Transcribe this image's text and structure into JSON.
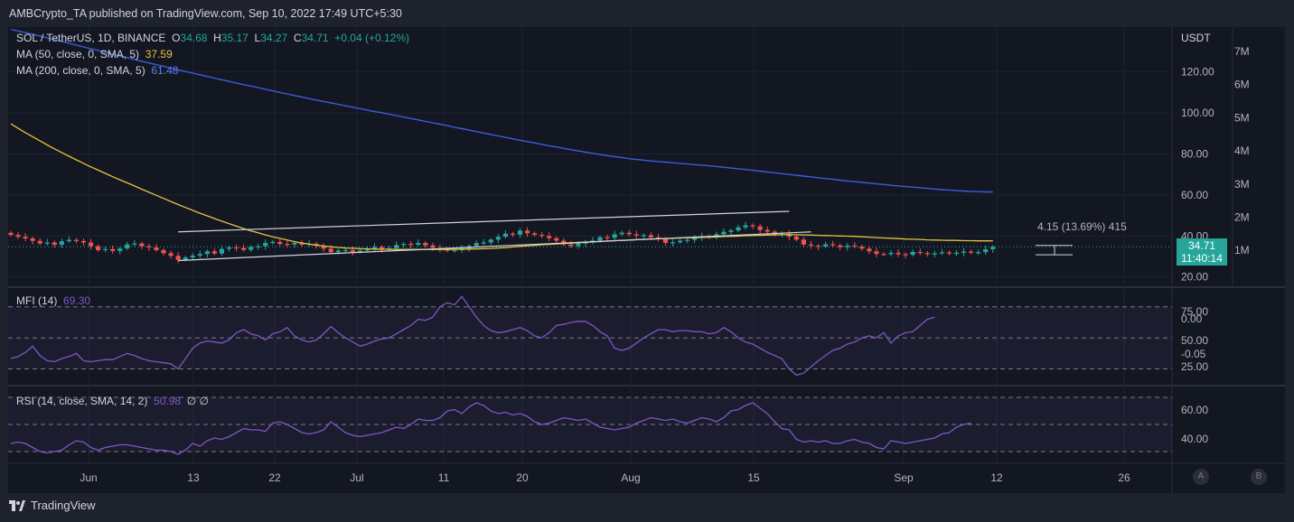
{
  "header": {
    "published": "AMBCrypto_TA published on TradingView.com, Sep 10, 2022 17:49 UTC+5:30"
  },
  "legend": {
    "symbol": "SOL / TetherUS, 1D, BINANCE",
    "o_label": "O",
    "o_value": "34.68",
    "h_label": "H",
    "h_value": "35.17",
    "l_label": "L",
    "l_value": "34.27",
    "c_label": "C",
    "c_value": "34.71",
    "change": "+0.04 (+0.12%)",
    "ma50_label": "MA (50, close, 0, SMA, 5)",
    "ma50_value": "37.59",
    "ma200_label": "MA (200, close, 0, SMA, 5)",
    "ma200_value": "61.48",
    "mfi_label": "MFI (14)",
    "mfi_value": "69.30",
    "rsi_label": "RSI (14, close, SMA, 14, 2)",
    "rsi_value": "50.98",
    "rsi_extra": "∅ ∅"
  },
  "currency": "USDT",
  "price_label": {
    "value": "34.71",
    "countdown": "11:40:14"
  },
  "measure_label": "4.15 (13.69%) 415",
  "buttons": {
    "a": "A",
    "b": "B"
  },
  "footer": {
    "brand": "TradingView"
  },
  "colors": {
    "up": "#26a69a",
    "down": "#ef5350",
    "ma50": "#e5c33e",
    "ma200": "#3c5ddb",
    "osc": "#7e57c2"
  },
  "chart_data": [
    {
      "type": "candlestick",
      "title": "SOL / TetherUS, 1D, BINANCE",
      "x_ticks": [
        "Jun",
        "13",
        "22",
        "Jul",
        "11",
        "20",
        "Aug",
        "15",
        "Sep",
        "12",
        "26"
      ],
      "y_ticks": [
        "120.00",
        "100.00",
        "80.00",
        "60.00",
        "40.00",
        "20.00"
      ],
      "volume_ticks": [
        "7M",
        "6M",
        "5M",
        "4M",
        "3M",
        "2M",
        "1M"
      ],
      "ylim": [
        15,
        141
      ],
      "close": [
        40.5,
        39.6,
        38.8,
        37.6,
        36.3,
        36.8,
        35.7,
        37.4,
        38.1,
        37.5,
        36.8,
        35.0,
        33.1,
        33.6,
        32.7,
        33.9,
        35.9,
        36.3,
        35.0,
        34.4,
        33.1,
        31.6,
        30.3,
        28.4,
        29.5,
        30.4,
        31.2,
        32.5,
        31.4,
        33.7,
        34.5,
        34.2,
        33.2,
        34.7,
        35.0,
        36.6,
        37.1,
        36.1,
        35.8,
        36.6,
        35.7,
        36.2,
        35.2,
        33.8,
        32.1,
        32.9,
        33.1,
        32.2,
        32.9,
        33.5,
        34.6,
        33.5,
        34.0,
        35.6,
        36.1,
        35.7,
        36.6,
        35.4,
        34.2,
        33.7,
        32.8,
        33.1,
        33.9,
        35.1,
        36.5,
        36.8,
        38.2,
        39.6,
        41.1,
        40.6,
        42.6,
        41.3,
        40.5,
        40.0,
        38.9,
        37.7,
        35.9,
        35.1,
        36.4,
        36.8,
        37.8,
        39.4,
        39.1,
        40.8,
        41.6,
        40.8,
        40.2,
        40.4,
        39.3,
        38.4,
        36.6,
        36.9,
        37.7,
        38.1,
        39.2,
        39.9,
        39.3,
        40.8,
        42.0,
        42.7,
        44.2,
        45.2,
        44.7,
        42.9,
        42.1,
        40.8,
        41.1,
        39.7,
        38.2,
        35.8,
        35.2,
        34.8,
        35.9,
        35.4,
        34.5,
        35.3,
        34.8,
        33.8,
        32.5,
        31.2,
        31.1,
        31.8,
        31.1,
        30.8,
        32.2,
        31.7,
        31.3,
        31.5,
        32.0,
        31.6,
        31.8,
        32.4,
        31.8,
        32.1,
        33.5,
        34.7
      ],
      "ma50": [
        94.7,
        92.5,
        90.4,
        88.4,
        86.4,
        84.4,
        82.5,
        80.7,
        78.9,
        77.1,
        75.4,
        73.7,
        72.1,
        70.5,
        68.9,
        67.4,
        65.9,
        64.4,
        62.8,
        61.3,
        59.8,
        58.3,
        56.8,
        55.3,
        53.9,
        52.5,
        51.1,
        49.8,
        48.5,
        47.2,
        46.0,
        44.8,
        43.6,
        42.5,
        41.5,
        40.5,
        39.6,
        38.8,
        38.0,
        37.2,
        36.6,
        36.0,
        35.5,
        35.1,
        34.7,
        34.4,
        34.1,
        34.0,
        33.8,
        33.7,
        33.6,
        33.5,
        33.5,
        33.4,
        33.4,
        33.4,
        33.4,
        33.4,
        33.4,
        33.4,
        33.4,
        33.5,
        33.5,
        33.6,
        33.7,
        33.8,
        33.9,
        34.1,
        34.3,
        34.6,
        34.9,
        35.2,
        35.4,
        35.7,
        35.9,
        36.1,
        36.3,
        36.5,
        36.7,
        36.9,
        37.1,
        37.3,
        37.5,
        37.7,
        37.8,
        38.0,
        38.2,
        38.3,
        38.5,
        38.6,
        38.7,
        38.8,
        39.0,
        39.1,
        39.2,
        39.3,
        39.4,
        39.5,
        39.7,
        39.8,
        39.9,
        40.1,
        40.2,
        40.3,
        40.4,
        40.5,
        40.6,
        40.6,
        40.6,
        40.5,
        40.4,
        40.3,
        40.2,
        40.1,
        40.0,
        39.9,
        39.8,
        39.6,
        39.4,
        39.2,
        39.0,
        38.9,
        38.7,
        38.5,
        38.4,
        38.3,
        38.1,
        38.0,
        37.9,
        37.8,
        37.8,
        37.7,
        37.7,
        37.6,
        37.6,
        37.59
      ],
      "ma200": [
        140.8,
        140.0,
        139.2,
        138.3,
        137.5,
        136.6,
        135.7,
        134.9,
        134.0,
        133.1,
        132.2,
        131.3,
        130.5,
        129.6,
        128.7,
        127.8,
        127.0,
        126.1,
        125.2,
        124.4,
        123.5,
        122.7,
        121.9,
        121.0,
        120.2,
        119.4,
        118.6,
        117.8,
        117.0,
        116.2,
        115.4,
        114.6,
        113.8,
        113.1,
        112.3,
        111.5,
        110.8,
        110.0,
        109.3,
        108.5,
        107.8,
        107.0,
        106.3,
        105.6,
        104.9,
        104.2,
        103.5,
        102.8,
        102.1,
        101.4,
        100.7,
        100.1,
        99.4,
        98.7,
        98.0,
        97.3,
        96.6,
        95.9,
        95.2,
        94.5,
        93.8,
        93.0,
        92.3,
        91.6,
        90.9,
        90.2,
        89.5,
        88.8,
        88.1,
        87.4,
        86.7,
        86.0,
        85.4,
        84.7,
        84.0,
        83.4,
        82.7,
        82.1,
        81.5,
        80.9,
        80.3,
        79.7,
        79.2,
        78.7,
        78.2,
        77.7,
        77.3,
        77.0,
        76.6,
        76.3,
        76.0,
        75.7,
        75.4,
        75.1,
        74.8,
        74.5,
        74.2,
        73.9,
        73.5,
        73.1,
        72.8,
        72.4,
        72.0,
        71.6,
        71.2,
        70.8,
        70.4,
        70.0,
        69.6,
        69.2,
        68.8,
        68.4,
        68.0,
        67.6,
        67.2,
        66.8,
        66.5,
        66.1,
        65.8,
        65.4,
        65.1,
        64.7,
        64.4,
        64.1,
        63.8,
        63.5,
        63.2,
        62.9,
        62.6,
        62.4,
        62.1,
        61.9,
        61.7,
        61.6,
        61.5,
        61.48
      ],
      "channel": {
        "upper": [
          [
            23,
            42.0
          ],
          [
            107,
            52.0
          ]
        ],
        "lower": [
          [
            23,
            28.0
          ],
          [
            110,
            42.0
          ]
        ]
      },
      "series": [
        {
          "name": "MA (50, close, 0, SMA, 5)",
          "last": 37.59
        },
        {
          "name": "MA (200, close, 0, SMA, 5)",
          "last": 61.48
        }
      ]
    },
    {
      "type": "line",
      "title": "MFI (14)",
      "y_ticks": [
        "75.00",
        "50.00",
        "0.00",
        "-0.05",
        "25.00"
      ],
      "bands": [
        80,
        50,
        20
      ],
      "ylim": [
        10,
        92
      ],
      "values": [
        30,
        32,
        36,
        42,
        33,
        28,
        27,
        30,
        32,
        35,
        28,
        27,
        28,
        29,
        29,
        32,
        35,
        33,
        30,
        28,
        27,
        26,
        25,
        20,
        30,
        40,
        45,
        47,
        46,
        45,
        48,
        55,
        58,
        54,
        52,
        48,
        54,
        56,
        60,
        52,
        48,
        46,
        48,
        54,
        61,
        55,
        50,
        46,
        42,
        44,
        47,
        49,
        50,
        54,
        58,
        62,
        68,
        67,
        70,
        80,
        84,
        82,
        90,
        80,
        70,
        62,
        57,
        55,
        56,
        58,
        60,
        57,
        52,
        50,
        55,
        62,
        63,
        65,
        66,
        66,
        62,
        56,
        52,
        40,
        38,
        40,
        45,
        50,
        54,
        58,
        58,
        56,
        57,
        57,
        56,
        56,
        54,
        55,
        60,
        56,
        50,
        46,
        44,
        40,
        36,
        33,
        30,
        20,
        14,
        16,
        22,
        28,
        33,
        38,
        40,
        44,
        46,
        50,
        52,
        50,
        55,
        45,
        52,
        55,
        56,
        62,
        68,
        70
      ]
    },
    {
      "type": "line",
      "title": "RSI (14, close, SMA, 14, 2)",
      "y_ticks": [
        "60.00",
        "40.00"
      ],
      "bands": [
        70,
        50,
        30
      ],
      "ylim": [
        26,
        74
      ],
      "values": [
        36,
        37,
        36,
        33,
        30,
        29,
        30,
        31,
        35,
        38,
        37,
        33,
        31,
        33,
        34,
        35,
        35,
        34,
        33,
        32,
        31,
        31,
        30,
        28,
        31,
        36,
        34,
        38,
        40,
        39,
        41,
        44,
        47,
        46,
        46,
        45,
        51,
        52,
        50,
        47,
        44,
        43,
        44,
        46,
        52,
        48,
        44,
        42,
        41,
        42,
        43,
        44,
        46,
        48,
        47,
        50,
        54,
        53,
        53,
        55,
        60,
        61,
        58,
        63,
        66,
        64,
        60,
        58,
        59,
        57,
        58,
        56,
        52,
        50,
        51,
        53,
        55,
        54,
        53,
        54,
        51,
        48,
        47,
        46,
        47,
        48,
        51,
        53,
        55,
        54,
        53,
        54,
        52,
        51,
        53,
        55,
        54,
        52,
        55,
        60,
        61,
        64,
        66,
        62,
        58,
        52,
        47,
        46,
        39,
        37,
        38,
        37,
        38,
        36,
        36,
        38,
        39,
        37,
        36,
        33,
        32,
        38,
        37,
        36,
        37,
        38,
        39,
        40,
        43,
        44,
        48,
        50,
        51
      ]
    }
  ]
}
